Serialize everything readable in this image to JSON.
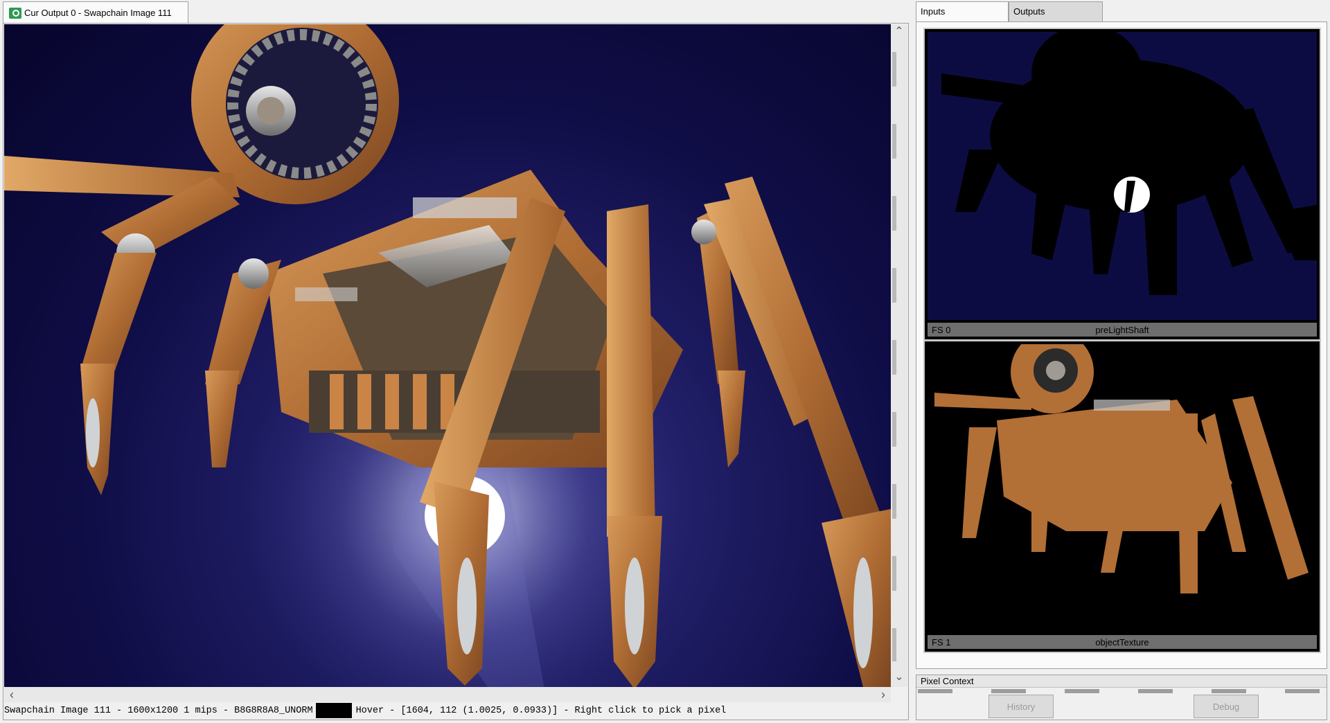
{
  "main_tab": {
    "title": "Cur Output 0 - Swapchain Image 111",
    "icon": "texture-viewer-icon"
  },
  "status": {
    "info": "Swapchain Image 111 - 1600x1200 1 mips - B8G8R8A8_UNORM",
    "hover": "Hover - [1604,  112 (1.0025, 0.0933)] - Right click to pick a pixel",
    "swatch_color": "#000000"
  },
  "right_tabs": [
    "Inputs",
    "Outputs"
  ],
  "thumbnails": [
    {
      "slot": "FS 0",
      "resource": "preLightShaft"
    },
    {
      "slot": "FS 1",
      "resource": "objectTexture"
    }
  ],
  "pixel_context": {
    "title": "Pixel Context",
    "history_label": "History",
    "debug_label": "Debug"
  },
  "colors": {
    "background_navy": "#0f0d45",
    "rust": "#b9753a",
    "thumb_background": "#000000",
    "thumb_label_bar": "#6e6e6e"
  }
}
